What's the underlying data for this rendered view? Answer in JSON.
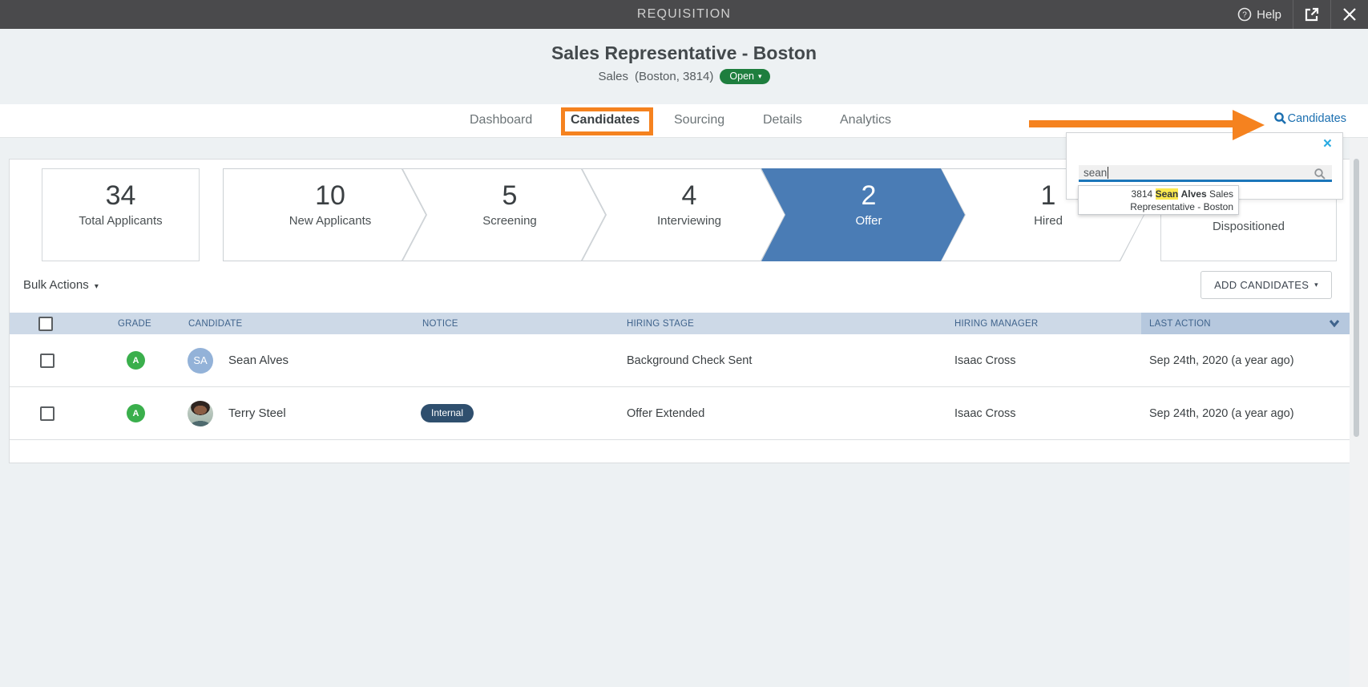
{
  "topbar": {
    "title": "REQUISITION",
    "help_label": "Help"
  },
  "job": {
    "title": "Sales Representative - Boston",
    "department": "Sales",
    "location_req": "(Boston, 3814)",
    "status": "Open"
  },
  "tabs": [
    {
      "label": "Dashboard",
      "active": false
    },
    {
      "label": "Candidates",
      "active": true
    },
    {
      "label": "Sourcing",
      "active": false
    },
    {
      "label": "Details",
      "active": false
    },
    {
      "label": "Analytics",
      "active": false
    }
  ],
  "candidate_search": {
    "link_label": "Candidates",
    "query": "sean",
    "suggestion": {
      "req_id": "3814",
      "match": "Sean",
      "name_rest": "Alves",
      "suffix": "Sales Representative - Boston"
    }
  },
  "funnel": {
    "stages": [
      {
        "count": "34",
        "label": "Total Applicants",
        "shape": "box",
        "active": false
      },
      {
        "count": "10",
        "label": "New Applicants",
        "shape": "chevron",
        "active": false
      },
      {
        "count": "5",
        "label": "Screening",
        "shape": "chevron",
        "active": false
      },
      {
        "count": "4",
        "label": "Interviewing",
        "shape": "chevron",
        "active": false
      },
      {
        "count": "2",
        "label": "Offer",
        "shape": "chevron",
        "active": true
      },
      {
        "count": "1",
        "label": "Hired",
        "shape": "chevron",
        "active": false
      },
      {
        "count": "",
        "label": "Dispositioned",
        "shape": "box",
        "active": false
      }
    ]
  },
  "toolbar": {
    "bulk_actions_label": "Bulk Actions",
    "add_candidates_label": "ADD CANDIDATES"
  },
  "table": {
    "columns": [
      "GRADE",
      "CANDIDATE",
      "NOTICE",
      "HIRING STAGE",
      "HIRING MANAGER",
      "LAST ACTION"
    ],
    "rows": [
      {
        "grade": "A",
        "initials": "SA",
        "name": "Sean Alves",
        "notice": "",
        "stage": "Background Check Sent",
        "manager": "Isaac Cross",
        "last_action": "Sep 24th, 2020 (a year ago)"
      },
      {
        "grade": "A",
        "initials": "",
        "name": "Terry Steel",
        "notice": "Internal",
        "stage": "Offer Extended",
        "manager": "Isaac Cross",
        "last_action": "Sep 24th, 2020 (a year ago)"
      }
    ]
  },
  "icons": {
    "caret_down": "▾",
    "close": "×"
  },
  "colors": {
    "annotation_orange": "#F5821F",
    "offer_blue": "#4A7CB5",
    "open_green": "#1E7E3E",
    "link_blue": "#1B6FB0",
    "highlight_yellow": "#FBE94E",
    "grade_green": "#3AAF4C",
    "internal_navy": "#2F4F6E",
    "table_header_blue": "#CDD9E7",
    "table_header_sorted_blue": "#B6C8DE",
    "topbar_gray": "#4A4A4C"
  }
}
